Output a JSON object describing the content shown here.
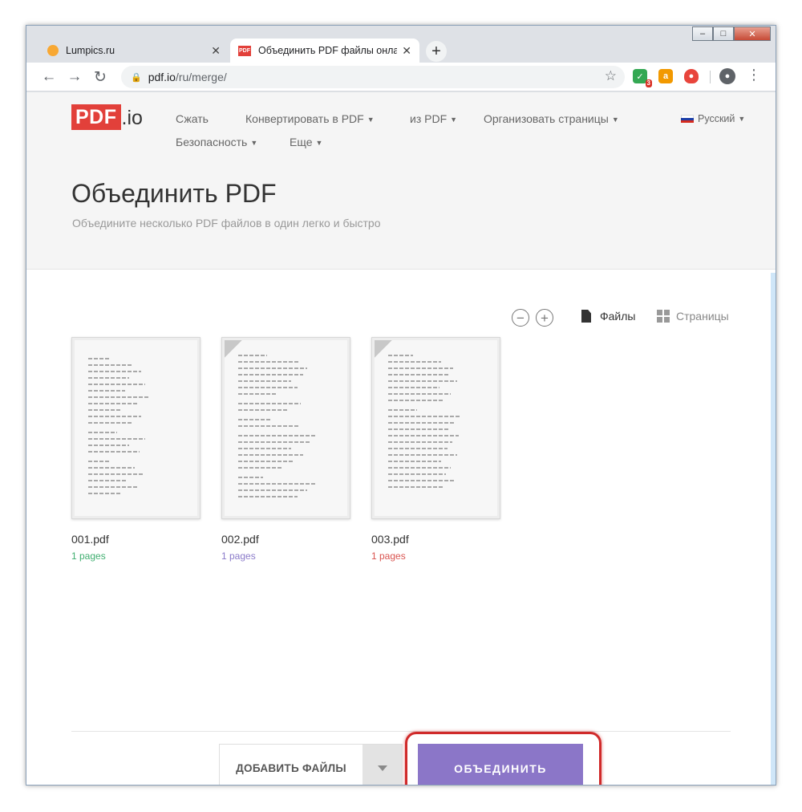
{
  "window": {
    "minimize": "‒",
    "maximize": "□",
    "close": "✕"
  },
  "tabs": [
    {
      "title": "Lumpics.ru",
      "favicon": "orange-slice-icon",
      "close": "✕"
    },
    {
      "title": "Объединить PDF файлы онлайн",
      "favicon": "PDF",
      "close": "✕"
    }
  ],
  "new_tab": "+",
  "toolbar": {
    "back": "←",
    "forward": "→",
    "reload": "↻",
    "url_host": "pdf.io",
    "url_path": "/ru/merge/",
    "star": "☆",
    "ext1_badge": "3",
    "ext2_letter": "a"
  },
  "site": {
    "logo_pdf": "PDF",
    "logo_io": ".io",
    "nav": [
      "Сжать",
      "Конвертировать в PDF",
      "из PDF",
      "Организовать страницы",
      "Безопасность",
      "Еще"
    ],
    "language": "Русский",
    "title": "Объединить PDF",
    "subtitle": "Объедините несколько PDF файлов в один легко и быстро"
  },
  "viewer": {
    "zoom_out": "−",
    "zoom_in": "+",
    "files_label": "Файлы",
    "pages_label": "Страницы"
  },
  "files": [
    {
      "name": "001.pdf",
      "pages": "1 pages",
      "color": "#3fae6f"
    },
    {
      "name": "002.pdf",
      "pages": "1 pages",
      "color": "#8a7ac9"
    },
    {
      "name": "003.pdf",
      "pages": "1 pages",
      "color": "#d9534f"
    }
  ],
  "actions": {
    "add_files": "ДОБАВИТЬ ФАЙЛЫ",
    "merge": "ОБЪЕДИНИТЬ"
  },
  "colors": {
    "brand_red": "#e2403a",
    "merge_purple": "#8b76c8",
    "highlight_red": "#d02a2a"
  }
}
